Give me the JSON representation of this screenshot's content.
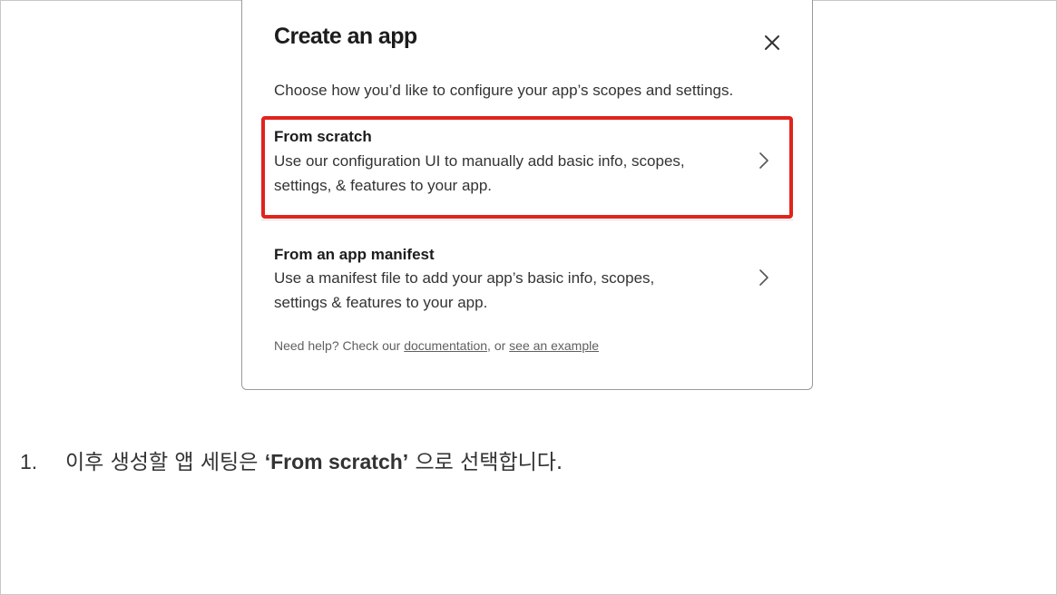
{
  "dialog": {
    "title": "Create an app",
    "subtitle": "Choose how you’d like to configure your app’s scopes and settings.",
    "close_icon": "close-icon",
    "options": [
      {
        "title": "From scratch",
        "description_line1": "Use our configuration UI to manually add basic info, scopes,",
        "description_line2": "settings, & features to your app.",
        "icon": "chevron-right-icon"
      },
      {
        "title": "From an app manifest",
        "description_line1": "Use a manifest file to add your app’s basic info, scopes,",
        "description_line2": "settings & features to your app.",
        "icon": "chevron-right-icon"
      }
    ],
    "help": {
      "prefix": "Need help? Check our ",
      "link1": "documentation",
      "middle": ", or ",
      "link2": "see an example"
    }
  },
  "annotation": {
    "highlight_color": "#e0231d"
  },
  "instruction": {
    "number": "1.",
    "text_before": "이후 생성할 앱 세팅은 ",
    "bold": "‘From scratch’",
    "text_after": " 으로 선택합니다."
  }
}
